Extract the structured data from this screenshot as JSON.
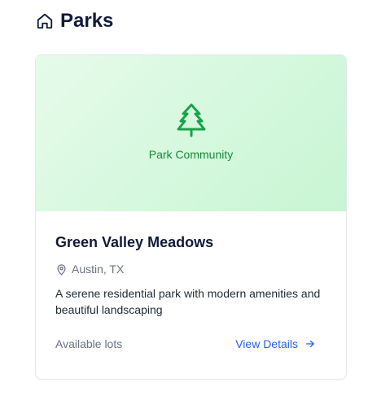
{
  "header": {
    "title": "Parks",
    "icon": "home-icon"
  },
  "card": {
    "hero_label": "Park Community",
    "hero_icon": "tree-icon",
    "name": "Green Valley Meadows",
    "location": "Austin, TX",
    "location_icon": "map-pin-icon",
    "description": "A serene residential park with modern amenities and beautiful landscaping",
    "availability_label": "Available lots",
    "view_details_label": "View Details",
    "view_details_icon": "arrow-right-icon"
  },
  "colors": {
    "title": "#111a3a",
    "accent_green": "#16a34a",
    "link_blue": "#2563eb",
    "muted_gray": "#6b7280"
  }
}
